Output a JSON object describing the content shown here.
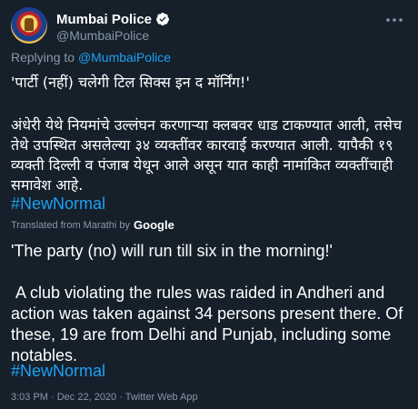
{
  "account": {
    "name": "Mumbai Police",
    "handle": "@MumbaiPolice"
  },
  "reply": {
    "prefix": "Replying to ",
    "mention": "@MumbaiPolice"
  },
  "tweet": {
    "quote_marathi": "'पार्टी (नहीं) चलेगी टिल सिक्स इन द मॉर्निंग!'",
    "body_marathi": "अंधेरी येथे नियमांचे उल्लंघन करणाऱ्या क्लबवर धाड टाकण्यात आली, तसेच तेथे उपस्थित असलेल्या ३४ व्यक्तींवर कारवाई करण्यात आली. यापैकी १९ व्यक्ती दिल्ली व पंजाब येथून आले असून यात काही नामांकित व्यक्तींचाही समावेश आहे.",
    "hashtag": "#NewNormal"
  },
  "translation": {
    "label": "Translated from Marathi by",
    "provider": "Google",
    "quote_english": "'The party (no) will run till six in the morning!'",
    "body_english": " A club violating the rules was raided in Andheri and action was taken against 34 persons present there. Of these, 19 are from Delhi and Punjab, including some notables.",
    "hashtag": "#NewNormal"
  },
  "meta": {
    "timestamp": "3:03 PM · Dec 22, 2020 · Twitter Web App"
  },
  "icons": {
    "verified": "verified-badge-icon",
    "more": "more-options-icon"
  },
  "colors": {
    "background": "#15202b",
    "link": "#1da1f2",
    "secondary_text": "#8899a6",
    "text": "#ffffff"
  }
}
